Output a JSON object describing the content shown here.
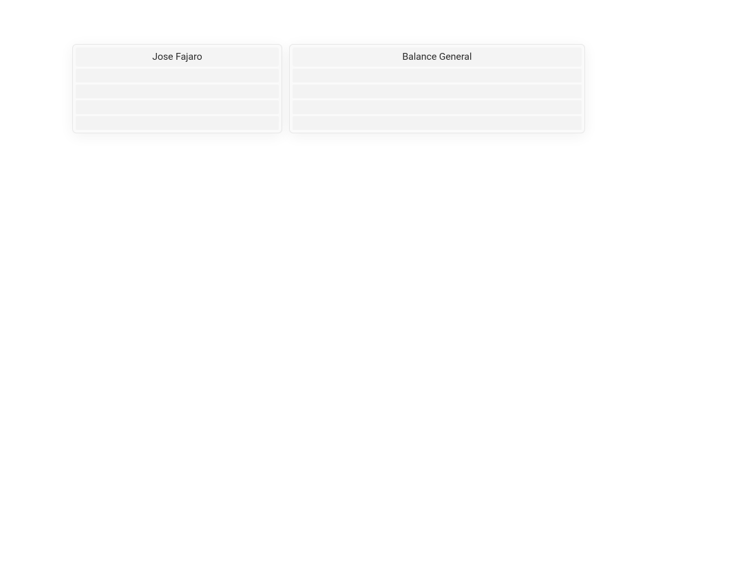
{
  "panels": {
    "left": {
      "title": "Jose Fajaro",
      "rows": [
        "",
        "",
        "",
        ""
      ]
    },
    "right": {
      "title": "Balance General",
      "rows": [
        "",
        "",
        "",
        ""
      ]
    }
  }
}
